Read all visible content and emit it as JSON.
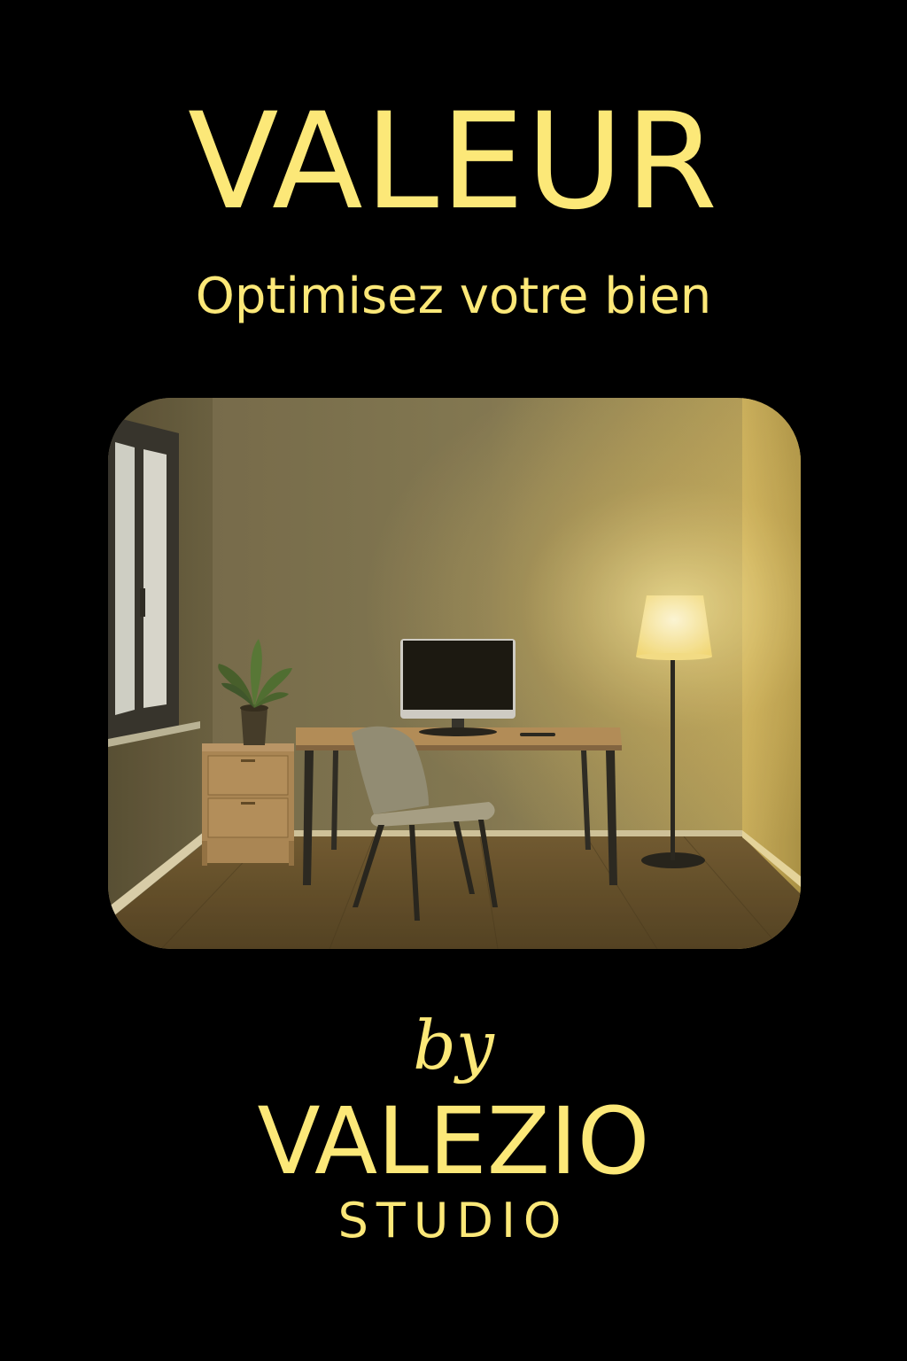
{
  "poster": {
    "headline": "VALEUR",
    "subline": "Optimisez votre bien",
    "by": "by",
    "brand_name": "VALEZIO",
    "brand_sub": "STUDIO"
  },
  "colors": {
    "background": "#000000",
    "text": "#FCE878",
    "lamp_glow": "#FFF3B0"
  },
  "photo": {
    "subject": "home office room with window, plant, drawer cabinet, desk, monitor, chair and floor lamp"
  }
}
